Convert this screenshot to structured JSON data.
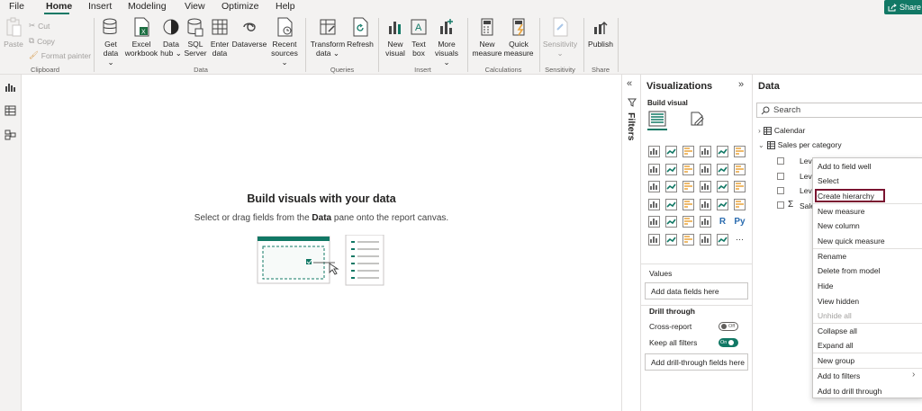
{
  "menu": {
    "tabs": [
      "File",
      "Home",
      "Insert",
      "Modeling",
      "View",
      "Optimize",
      "Help"
    ],
    "active": "Home",
    "share_label": "Share"
  },
  "ribbon": {
    "clipboard": {
      "paste": "Paste",
      "cut": "Cut",
      "copy": "Copy",
      "format_painter": "Format painter",
      "group": "Clipboard"
    },
    "data": {
      "get_data": [
        "Get",
        "data ⌄"
      ],
      "excel": [
        "Excel",
        "workbook"
      ],
      "data_hub": [
        "Data",
        "hub ⌄"
      ],
      "sql": [
        "SQL",
        "Server"
      ],
      "enter_data": [
        "Enter",
        "data"
      ],
      "dataverse": [
        "Dataverse",
        ""
      ],
      "recent": [
        "Recent",
        "sources ⌄"
      ],
      "group": "Data"
    },
    "queries": {
      "transform": [
        "Transform",
        "data ⌄"
      ],
      "refresh": [
        "Refresh",
        ""
      ],
      "group": "Queries"
    },
    "insert": {
      "new_visual": [
        "New",
        "visual"
      ],
      "text_box": [
        "Text",
        "box"
      ],
      "more_visuals": [
        "More",
        "visuals ⌄"
      ],
      "group": "Insert"
    },
    "calculations": {
      "new_measure": [
        "New",
        "measure"
      ],
      "quick_measure": [
        "Quick",
        "measure"
      ],
      "group": "Calculations"
    },
    "sensitivity": {
      "label": [
        "Sensitivity",
        "⌄"
      ],
      "group": "Sensitivity"
    },
    "share": {
      "publish": [
        "Publish",
        ""
      ],
      "group": "Share"
    }
  },
  "canvas": {
    "title": "Build visuals with your data",
    "subtitle_before": "Select or drag fields from the ",
    "subtitle_bold": "Data",
    "subtitle_after": " pane onto the report canvas."
  },
  "filters": {
    "label": "Filters"
  },
  "visualizations": {
    "title": "Visualizations",
    "build_visual": "Build visual",
    "values_label": "Values",
    "values_placeholder": "Add data fields here",
    "drill_through": "Drill through",
    "cross_report": "Cross-report",
    "cross_report_state": "Off",
    "keep_all_filters": "Keep all filters",
    "keep_all_filters_state": "On",
    "drill_placeholder": "Add drill-through fields here",
    "more_icon": "···"
  },
  "data_pane": {
    "title": "Data",
    "search_placeholder": "Search",
    "tables": [
      {
        "name": "Calendar",
        "expanded": false
      },
      {
        "name": "Sales per category",
        "expanded": true
      }
    ],
    "fields": [
      "Lev",
      "Lev",
      "Lev",
      "Sale"
    ]
  },
  "context_menu": {
    "items": [
      "Add to field well",
      "Select",
      "Create hierarchy",
      "New measure",
      "New column",
      "New quick measure",
      "Rename",
      "Delete from model",
      "Hide",
      "View hidden",
      "Unhide all",
      "Collapse all",
      "Expand all",
      "New group",
      "Add to filters",
      "Add to drill through"
    ],
    "highlighted": "Create hierarchy",
    "disabled": [
      "Unhide all"
    ]
  },
  "colors": {
    "accent": "#117865",
    "highlight_border": "#7a1430"
  }
}
